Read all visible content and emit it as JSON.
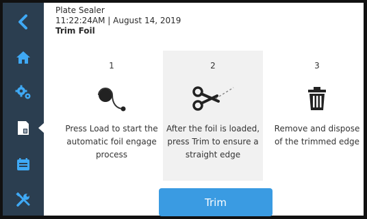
{
  "header": {
    "app_title": "Plate Sealer",
    "datetime": "11:22:24AM | August 14, 2019",
    "section": "Trim Foil"
  },
  "sidebar": {
    "items": [
      {
        "icon": "back-chevron-icon"
      },
      {
        "icon": "home-icon"
      },
      {
        "icon": "settings-gears-icon"
      },
      {
        "icon": "seal-plate-icon",
        "selected": true
      },
      {
        "icon": "calendar-icon"
      },
      {
        "icon": "tools-icon"
      }
    ]
  },
  "steps": [
    {
      "number": "1",
      "icon": "foil-load-icon",
      "text": "Press Load to start the automatic foil engage process"
    },
    {
      "number": "2",
      "icon": "scissors-cut-icon",
      "text": "After the foil is loaded, press Trim to ensure a straight edge",
      "active": true
    },
    {
      "number": "3",
      "icon": "trash-icon",
      "text": "Remove and dispose of the trimmed edge"
    }
  ],
  "actions": {
    "trim_label": "Trim"
  },
  "colors": {
    "sidebar": "#2b3e50",
    "accent": "#3a9be2",
    "active_step_bg": "#f1f1f1"
  }
}
